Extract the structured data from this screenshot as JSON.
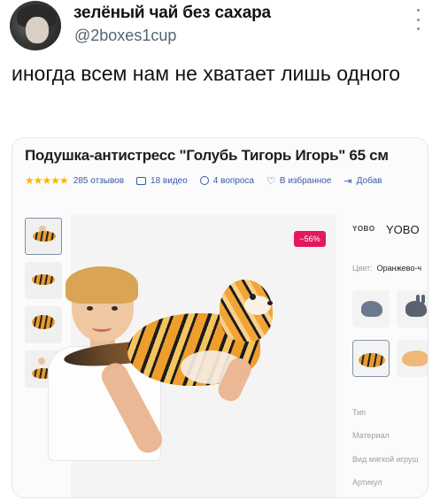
{
  "tweet": {
    "display_name": "зелёный чай без сахара",
    "handle": "@2boxes1cup",
    "text": "иногда всем нам не хватает лишь одного"
  },
  "product": {
    "title": "Подушка-антистресс \"Голубь Тигорь Игорь\" 65 см",
    "stars": "★★★★★",
    "reviews": "285 отзывов",
    "videos": "18 видео",
    "questions": "4 вопроса",
    "favorite": "В избранное",
    "add": "Добав",
    "discount": "−56%",
    "brand_logo": "YOBO",
    "brand_name": "YOBO",
    "color_label": "Цвет:",
    "color_value": "Оранжево-ч",
    "specs": [
      "Тип",
      "Материал",
      "Вид мягкой игруш",
      "Артикул"
    ]
  },
  "icons": [
    "more-icon",
    "video-icon",
    "question-icon",
    "heart-icon",
    "add-icon"
  ],
  "colors": {
    "accent": "#3a5aa8",
    "discount": "#e2195b",
    "stars": "#f6b700"
  }
}
